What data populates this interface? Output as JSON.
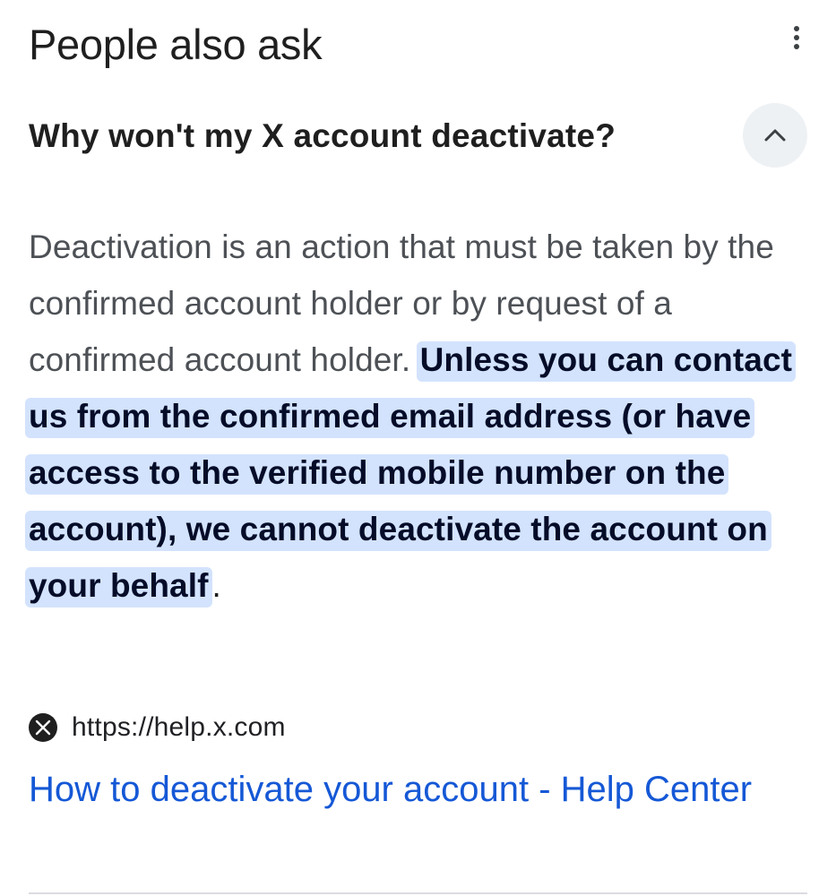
{
  "section": {
    "title": "People also ask",
    "more_icon": "more-vert-icon"
  },
  "question": {
    "text": "Why won't my X account deactivate?",
    "toggle_icon": "chevron-up-icon",
    "expanded": true
  },
  "answer": {
    "plain": "Deactivation is an action that must be taken by the confirmed account holder or by request of a confirmed account holder. ",
    "highlighted": "Unless you can contact us from the confirmed email address (or have access to the verified mobile number on the account), we cannot deactivate the account on your behalf",
    "trailing": "."
  },
  "source": {
    "favicon_icon": "x-logo-icon",
    "url": "https://help.x.com"
  },
  "result": {
    "title": "How to deactivate your account - Help Center"
  },
  "colors": {
    "link": "#1558d6",
    "highlight": "#d3e3fd",
    "button_bg": "#eef1f4"
  }
}
